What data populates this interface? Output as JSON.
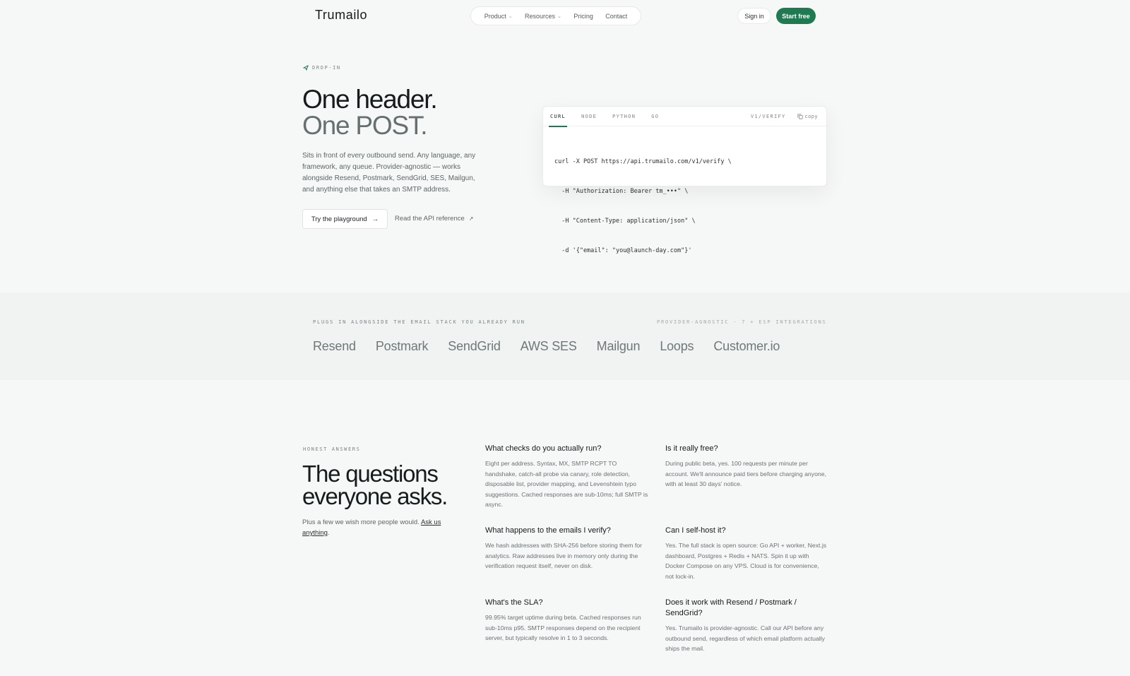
{
  "nav": {
    "logo": "Trumailo",
    "items": [
      {
        "label": "Product",
        "has_dropdown": true
      },
      {
        "label": "Resources",
        "has_dropdown": true
      },
      {
        "label": "Pricing",
        "has_dropdown": false
      },
      {
        "label": "Contact",
        "has_dropdown": false
      }
    ],
    "signin": "Sign in",
    "start_free": "Start free"
  },
  "hero": {
    "eyebrow": "DROP-IN",
    "title_line1": "One header.",
    "title_line2": "One POST.",
    "description": "Sits in front of every outbound send. Any language, any framework, any queue. Provider-agnostic — works alongside Resend, Postmark, SendGrid, SES, Mailgun, and anything else that takes an SMTP address.",
    "primary_button": "Try the playground",
    "secondary_link": "Read the API reference"
  },
  "code": {
    "tabs": [
      "CURL",
      "NODE",
      "PYTHON",
      "GO"
    ],
    "active_tab": "CURL",
    "endpoint": "V1/VERIFY",
    "copy_label": "copy",
    "lines": [
      "curl -X POST https://api.trumailo.com/v1/verify \\",
      "  -H \"Authorization: Bearer tm_•••\" \\",
      "  -H \"Content-Type: application/json\" \\",
      "  -d '{\"email\": \"you@launch-day.com\"}'"
    ]
  },
  "integrations": {
    "left_label": "PLUGS IN ALONGSIDE THE EMAIL STACK YOU ALREADY RUN",
    "right_label": "PROVIDER-AGNOSTIC · 7 + ESP INTEGRATIONS",
    "brands": [
      "Resend",
      "Postmark",
      "SendGrid",
      "AWS SES",
      "Mailgun",
      "Loops",
      "Customer.io"
    ]
  },
  "faq": {
    "eyebrow": "HONEST ANSWERS",
    "title": "The questions everyone asks.",
    "subtitle_prefix": "Plus a few we wish more people would.",
    "subtitle_link": "Ask us anything",
    "subtitle_suffix": ".",
    "items": [
      {
        "q": "What checks do you actually run?",
        "a": "Eight per address. Syntax, MX, SMTP RCPT TO handshake, catch-all probe via canary, role detection, disposable list, provider mapping, and Levenshtein typo suggestions. Cached responses are sub-10ms; full SMTP is async."
      },
      {
        "q": "Is it really free?",
        "a": "During public beta, yes. 100 requests per minute per account. We'll announce paid tiers before charging anyone, with at least 30 days' notice."
      },
      {
        "q": "What happens to the emails I verify?",
        "a": "We hash addresses with SHA-256 before storing them for analytics. Raw addresses live in memory only during the verification request itself, never on disk."
      },
      {
        "q": "Can I self-host it?",
        "a": "Yes. The full stack is open source: Go API + worker, Next.js dashboard, Postgres + Redis + NATS. Spin it up with Docker Compose on any VPS. Cloud is for convenience, not lock-in."
      },
      {
        "q": "What's the SLA?",
        "a": "99.95% target uptime during beta. Cached responses run sub-10ms p95. SMTP responses depend on the recipient server, but typically resolve in 1 to 3 seconds."
      },
      {
        "q": "Does it work with Resend / Postmark / SendGrid?",
        "a": "Yes. Trumailo is provider-agnostic. Call our API before any outbound send, regardless of which email platform actually ships the mail."
      }
    ]
  }
}
